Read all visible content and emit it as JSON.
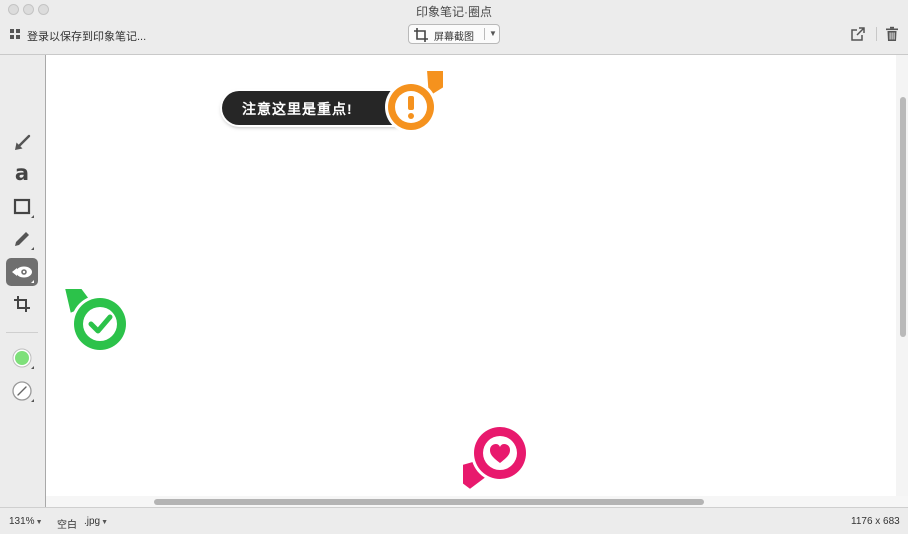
{
  "window": {
    "title": "印象笔记·圈点"
  },
  "toolbar": {
    "signin_label": "登录以保存到印象笔记...",
    "capture_label": "屏幕截图"
  },
  "palette": {
    "tools": [
      {
        "name": "arrow-tool",
        "icon": "arrow-icon"
      },
      {
        "name": "text-tool",
        "icon": "text-icon",
        "glyph": "a"
      },
      {
        "name": "rectangle-tool",
        "icon": "rectangle-icon"
      },
      {
        "name": "pen-tool",
        "icon": "pen-icon"
      },
      {
        "name": "stamp-tool",
        "icon": "eye-stamp-icon",
        "active": true
      },
      {
        "name": "crop-tool",
        "icon": "crop-icon"
      }
    ],
    "color_swatch": "#7ee07a",
    "line_width_icon": "line-width-icon"
  },
  "canvas": {
    "callout_text": "注意这里是重点!",
    "stamps": [
      {
        "name": "exclamation-stamp",
        "color": "#f5921e"
      },
      {
        "name": "checkmark-stamp",
        "color": "#2cc24a"
      },
      {
        "name": "heart-stamp",
        "color": "#e8196d"
      }
    ],
    "callout_color": "#262626"
  },
  "statusbar": {
    "zoom": "131%",
    "background": "空白",
    "format": ".jpg",
    "dimensions": "1176 x 683"
  }
}
